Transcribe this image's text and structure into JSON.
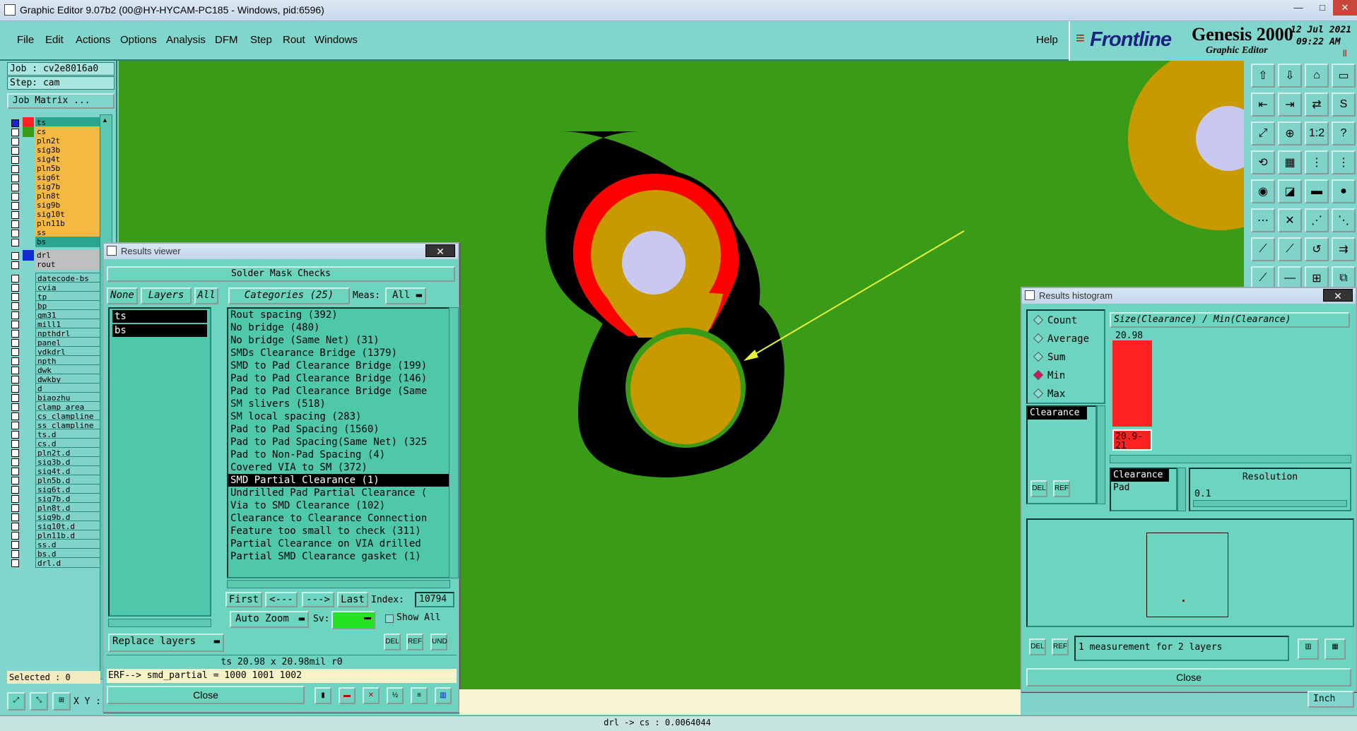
{
  "window": {
    "title": "Graphic Editor 9.07b2 (00@HY-HYCAM-PC185 - Windows, pid:6596)",
    "minimize": "—",
    "maximize": "□",
    "close": "✕"
  },
  "menu": {
    "items": [
      "File",
      "Edit",
      "Actions",
      "Options",
      "Analysis",
      "DFM",
      "Step",
      "Rout",
      "Windows"
    ],
    "help": "Help"
  },
  "logo": {
    "brand": "Frontline",
    "product": "Genesis 2000",
    "subtitle": "Graphic Editor",
    "date": "12 Jul 2021",
    "time": "09:22 AM"
  },
  "job": {
    "job_label": "Job : cv2e8016a0",
    "step_label": "Step: cam",
    "matrix_button": "Job Matrix ..."
  },
  "layers": [
    {
      "name": "ts",
      "color": "#ff2020",
      "bg": "#2aa58f",
      "sel": true
    },
    {
      "name": "cs",
      "color": "#3a9b16",
      "bg": "#f4b942"
    },
    {
      "name": "pln2t",
      "color": "",
      "bg": "#f4b942"
    },
    {
      "name": "sig3b",
      "color": "",
      "bg": "#f4b942"
    },
    {
      "name": "sig4t",
      "color": "",
      "bg": "#f4b942"
    },
    {
      "name": "pln5b",
      "color": "",
      "bg": "#f4b942"
    },
    {
      "name": "sig6t",
      "color": "",
      "bg": "#f4b942"
    },
    {
      "name": "sig7b",
      "color": "",
      "bg": "#f4b942"
    },
    {
      "name": "pln8t",
      "color": "",
      "bg": "#f4b942"
    },
    {
      "name": "sig9b",
      "color": "",
      "bg": "#f4b942"
    },
    {
      "name": "sig10t",
      "color": "",
      "bg": "#f4b942"
    },
    {
      "name": "pln11b",
      "color": "",
      "bg": "#f4b942"
    },
    {
      "name": "ss",
      "color": "",
      "bg": "#f4b942"
    },
    {
      "name": "bs",
      "color": "",
      "bg": "#2aa58f"
    }
  ],
  "drill_layers": [
    {
      "name": "drl",
      "color": "#1428d8",
      "bg": "#bfbfbf"
    },
    {
      "name": "rout",
      "color": "",
      "bg": "#bfbfbf"
    }
  ],
  "misc_layers": [
    "datecode-bs",
    "cvia",
    "tp",
    "bp",
    "gm31",
    "mill1",
    "npthdrl",
    "panel",
    "ydkdrl",
    "npth",
    "dwk",
    "dwkby",
    "d",
    "biaozhu",
    "clamp_area",
    "cs_clampline",
    "ss_clampline",
    "ts.d",
    "cs.d",
    "pln2t.d",
    "sig3b.d",
    "sig4t.d",
    "pln5b.d",
    "sig6t.d",
    "sig7b.d",
    "pln8t.d",
    "sig9b.d",
    "sig10t.d",
    "pln11b.d",
    "ss.d",
    "bs.d",
    "drl.d"
  ],
  "selected_label": "Selected : 0",
  "xy_label": "X Y :",
  "units": "Inch",
  "status_bar": "drl -> cs : 0.0064044",
  "results_viewer": {
    "title": "Results viewer",
    "header": "Solder Mask Checks",
    "none_btn": "None",
    "layers_btn": "Layers",
    "all_btn": "All",
    "categories_btn": "Categories (25)",
    "meas_label": "Meas:",
    "meas_value": "All",
    "layers": [
      "ts",
      "bs"
    ],
    "categories": [
      "Rout spacing (392)",
      "No bridge (480)",
      "No bridge (Same Net) (31)",
      "SMDs Clearance Bridge (1379)",
      "SMD to Pad Clearance Bridge (199)",
      "Pad to Pad Clearance Bridge (146)",
      "Pad to Pad Clearance Bridge (Same",
      "SM slivers (518)",
      "SM local spacing (283)",
      "Pad to Pad Spacing (1560)",
      "Pad to Pad Spacing(Same Net) (325",
      "Pad to Non-Pad Spacing (4)",
      "Covered VIA to SM (372)",
      "SMD Partial Clearance (1)",
      "Undrilled Pad Partial Clearance (",
      "Via to SMD Clearance (102)",
      "Clearance to Clearance Connection",
      "Feature too small to check (311)",
      "Partial Clearance on VIA drilled",
      "Partial SMD Clearance gasket (1)"
    ],
    "selected_category_index": 13,
    "first": "First",
    "prev": "<---",
    "next": "--->",
    "last": "Last",
    "index_label": "Index:",
    "index_value": "10794",
    "auto_zoom": "Auto Zoom",
    "sv_label": "Sv:",
    "show_all": "Show All",
    "replace_layers": "Replace layers",
    "measure_text": "ts 20.98 x 20.98mil  r0",
    "erf_text": "ERF--> smd_partial = 1000 1001 1002",
    "close": "Close"
  },
  "histogram": {
    "title": "Results histogram",
    "options": [
      "Count",
      "Average",
      "Sum",
      "Min",
      "Max"
    ],
    "selected_option": "Min",
    "header": "Size(Clearance) / Min(Clearance)",
    "top_value": "20.98",
    "bin_label": "20.9- 21",
    "bar_fraction": 1.0,
    "attr_list": [
      "Clearance"
    ],
    "type_list": [
      "Clearance",
      "Pad"
    ],
    "resolution_label": "Resolution",
    "resolution_value": "0.1",
    "summary": "1 measurement for 2 layers",
    "close": "Close",
    "bar_color": "#ff2020"
  }
}
